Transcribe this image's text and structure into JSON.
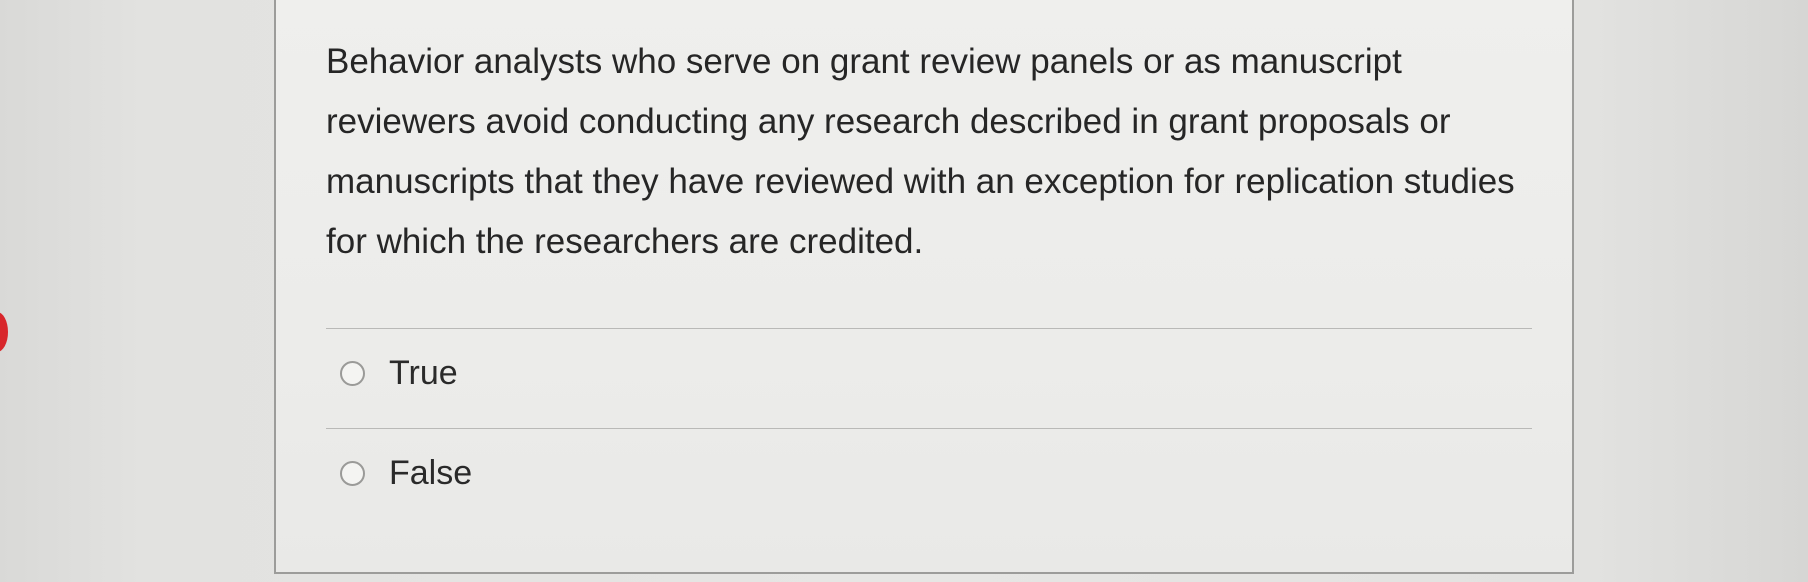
{
  "question": {
    "text": "Behavior analysts who serve on grant review panels or as manuscript reviewers avoid conducting any research described in grant proposals or manuscripts that they have reviewed with an exception for replication studies for which the researchers are credited."
  },
  "options": [
    {
      "label": "True",
      "selected": false
    },
    {
      "label": "False",
      "selected": false
    }
  ],
  "colors": {
    "marker": "#d8262b",
    "text": "#262626",
    "border": "#9c9c9a"
  }
}
